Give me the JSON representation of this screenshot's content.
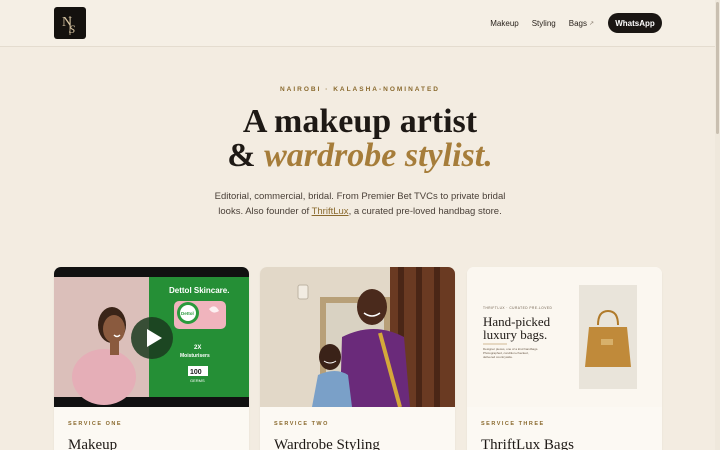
{
  "header": {
    "logo_text": "NS",
    "nav": [
      {
        "label": "Makeup"
      },
      {
        "label": "Styling"
      },
      {
        "label": "Bags",
        "icon": "external-link-icon"
      }
    ],
    "cta_label": "WhatsApp"
  },
  "hero": {
    "eyebrow": "NAIROBI · KALASHA-NOMINATED",
    "headline_line1": "A makeup artist",
    "headline_amp": "& ",
    "headline_accent": "wardrobe stylist.",
    "sub_line1": "Editorial, commercial, bridal. From Premier Bet TVCs to private bridal",
    "sub_line2_prefix": "looks. Also founder of ",
    "sub_link": "ThriftLux",
    "sub_line2_suffix": ", a curated pre-loved handbag store."
  },
  "cards": [
    {
      "label": "SERVICE ONE",
      "title": "Makeup",
      "media": {
        "brand": "Dettol Skincare.",
        "pack_text": "Dettol",
        "claim": "2X",
        "claim_sub": "Moisturisers",
        "count": "100",
        "count_unit": "GERMS"
      }
    },
    {
      "label": "SERVICE TWO",
      "title": "Wardrobe Styling"
    },
    {
      "label": "SERVICE THREE",
      "title": "ThriftLux Bags",
      "media": {
        "eyebrow": "THRIFTLUX · CURATED PRE-LOVED",
        "headline_line1": "Hand-picked",
        "headline_line2": "luxury bags.",
        "body_line1": "Designer pieces, one of a kind handbags.",
        "body_line2": "Photographed, condition-checked,",
        "body_line3": "delivered countrywide."
      }
    }
  ],
  "colors": {
    "background": "#f3ece1",
    "accent": "#a67d3a",
    "dark": "#1a1613",
    "dettol_green": "#2a9a3c"
  }
}
